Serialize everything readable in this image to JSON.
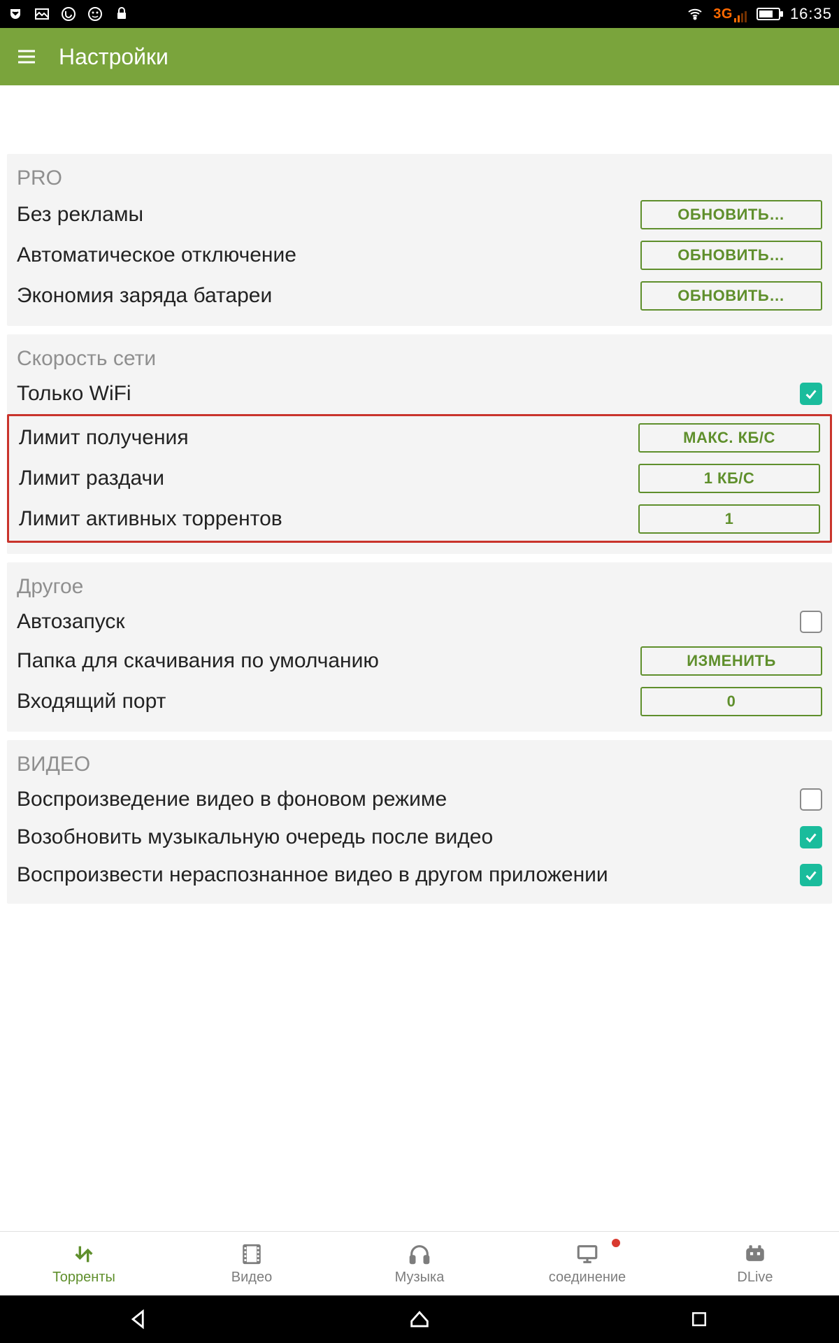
{
  "statusbar": {
    "network_label": "3G",
    "time": "16:35"
  },
  "appbar": {
    "title": "Настройки"
  },
  "sections": {
    "pro": {
      "title": "PRO",
      "no_ads": {
        "label": "Без рекламы",
        "button": "ОБНОВИТЬ…"
      },
      "auto_off": {
        "label": "Автоматическое отключение",
        "button": "ОБНОВИТЬ…"
      },
      "battery": {
        "label": "Экономия заряда батареи",
        "button": "ОБНОВИТЬ…"
      }
    },
    "network": {
      "title": "Скорость сети",
      "wifi_only": {
        "label": "Только WiFi",
        "checked": true
      },
      "dl_limit": {
        "label": "Лимит получения",
        "button": "МАКС. КБ/С"
      },
      "ul_limit": {
        "label": "Лимит раздачи",
        "button": "1 КБ/С"
      },
      "active_limit": {
        "label": "Лимит активных торрентов",
        "button": "1"
      }
    },
    "other": {
      "title": "Другое",
      "autostart": {
        "label": "Автозапуск",
        "checked": false
      },
      "download_folder": {
        "label": "Папка для скачивания по умолчанию",
        "button": "ИЗМЕНИТЬ"
      },
      "incoming_port": {
        "label": "Входящий порт",
        "button": "0"
      }
    },
    "video": {
      "title": "ВИДЕО",
      "bg_play": {
        "label": "Воспроизведение видео в фоновом режиме",
        "checked": false
      },
      "resume_music": {
        "label": "Возобновить музыкальную очередь после видео",
        "checked": true
      },
      "external_play": {
        "label": "Воспроизвести нераспознанное видео в другом приложении",
        "checked": true
      }
    }
  },
  "tabs": {
    "torrents": "Торренты",
    "video": "Видео",
    "music": "Музыка",
    "connection": "соединение",
    "dlive": "DLive"
  }
}
